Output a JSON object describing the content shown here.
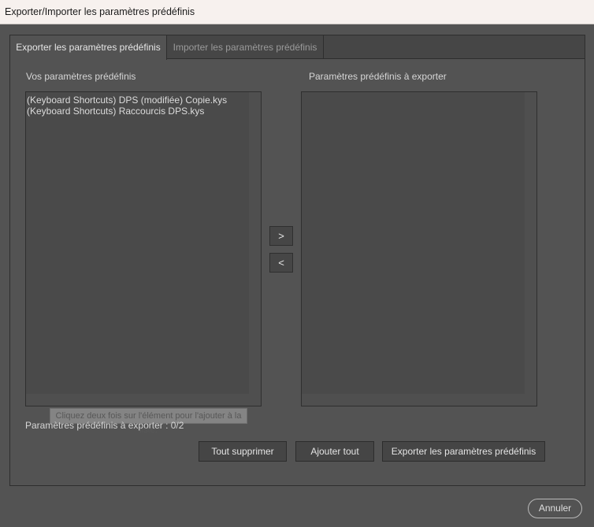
{
  "window": {
    "title": "Exporter/Importer les paramètres prédéfinis"
  },
  "tabs": [
    {
      "label": "Exporter les paramètres prédéfinis",
      "active": true
    },
    {
      "label": "Importer les paramètres prédéfinis",
      "active": false
    }
  ],
  "left_list": {
    "heading": "Vos paramètres prédéfinis",
    "items": [
      "(Keyboard Shortcuts)  DPS (modifiée) Copie.kys",
      "(Keyboard Shortcuts)  Raccourcis DPS.kys"
    ]
  },
  "right_list": {
    "heading": "Paramètres prédéfinis à exporter",
    "items": []
  },
  "arrows": {
    "add": ">",
    "remove": "<"
  },
  "tooltip": "Cliquez deux fois sur l'élément pour l'ajouter à la liste.",
  "status": "Paramètres prédéfinis à exporter : 0/2",
  "buttons": {
    "clear_all": "Tout supprimer",
    "add_all": "Ajouter tout",
    "export": "Exporter les paramètres prédéfinis",
    "cancel": "Annuler"
  },
  "colors": {
    "background": "#535353",
    "titlebar": "#f7f1ee",
    "list_bg": "#4a4a4a"
  }
}
